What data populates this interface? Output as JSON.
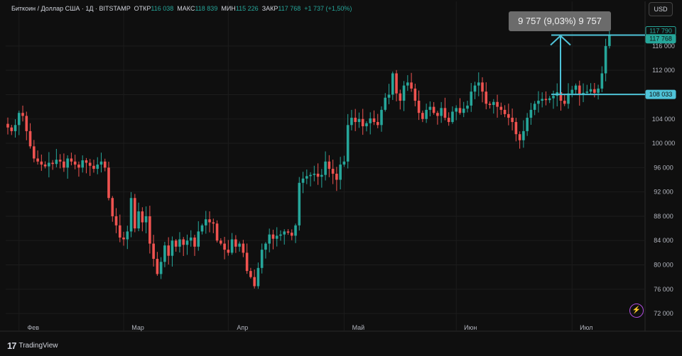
{
  "header": {
    "symbol": "Биткоин / Доллар США · 1Д · BITSTAMP",
    "open_label": "ОТКР",
    "open_value": "116 038",
    "high_label": "МАКС",
    "high_value": "118 839",
    "low_label": "МИН",
    "low_value": "115 226",
    "close_label": "ЗАКР",
    "close_value": "117 768",
    "change": "+1 737 (+1,50%)"
  },
  "currency_button": "USD",
  "measure_label": "9 757 (9,03%) 9 757",
  "branding": "TradingView",
  "colors": {
    "up": "#26a69a",
    "down": "#ef5350",
    "measure_line": "#4fc3d8",
    "background": "#0f0f0f"
  },
  "chart_data": {
    "type": "candlestick",
    "symbol": "BTC/USD",
    "timeframe": "1D",
    "x_labels": [
      "Фев",
      "Мар",
      "Апр",
      "Май",
      "Июн",
      "Июл"
    ],
    "y_ticks": [
      72000,
      76000,
      80000,
      84000,
      88000,
      92000,
      96000,
      100000,
      104000,
      108000,
      112000,
      116000
    ],
    "ylim": [
      70500,
      121000
    ],
    "price_labels": [
      {
        "value": 117790,
        "text": "117 790",
        "style": "outline"
      },
      {
        "value": 117768,
        "text": "117 768",
        "style": "filled"
      },
      {
        "value": 108033,
        "text": "108 033",
        "style": "filled"
      }
    ],
    "measure": {
      "from": 108033,
      "to": 117790,
      "text": "9 757 (9,03%) 9 757"
    },
    "month_index": {
      "Фев": 3,
      "Мар": 31,
      "Апр": 59,
      "Май": 90,
      "Июн": 120,
      "Июл": 151
    },
    "anchors": [
      [
        0,
        102600
      ],
      [
        1,
        102000
      ],
      [
        2,
        103000
      ],
      [
        3,
        105000
      ],
      [
        4,
        104500
      ],
      [
        5,
        102000
      ],
      [
        6,
        99500
      ],
      [
        7,
        97500
      ],
      [
        8,
        97000
      ],
      [
        9,
        96500
      ],
      [
        10,
        96200
      ],
      [
        11,
        96800
      ],
      [
        12,
        96600
      ],
      [
        13,
        97300
      ],
      [
        14,
        97000
      ],
      [
        15,
        96000
      ],
      [
        16,
        97500
      ],
      [
        17,
        97000
      ],
      [
        18,
        96500
      ],
      [
        19,
        96000
      ],
      [
        20,
        97200
      ],
      [
        21,
        96800
      ],
      [
        22,
        96300
      ],
      [
        23,
        95800
      ],
      [
        24,
        96500
      ],
      [
        25,
        97000
      ],
      [
        26,
        96000
      ],
      [
        27,
        91000
      ],
      [
        28,
        88000
      ],
      [
        29,
        86500
      ],
      [
        30,
        84500
      ],
      [
        31,
        84200
      ],
      [
        32,
        85500
      ],
      [
        33,
        91000
      ],
      [
        34,
        86000
      ],
      [
        35,
        88800
      ],
      [
        36,
        87000
      ],
      [
        37,
        88000
      ],
      [
        38,
        83500
      ],
      [
        39,
        81000
      ],
      [
        40,
        78500
      ],
      [
        41,
        80500
      ],
      [
        42,
        83200
      ],
      [
        43,
        81500
      ],
      [
        44,
        84000
      ],
      [
        45,
        83000
      ],
      [
        46,
        84200
      ],
      [
        47,
        83300
      ],
      [
        48,
        84000
      ],
      [
        49,
        84500
      ],
      [
        50,
        83000
      ],
      [
        51,
        85500
      ],
      [
        52,
        86500
      ],
      [
        53,
        87500
      ],
      [
        54,
        87000
      ],
      [
        55,
        86800
      ],
      [
        56,
        84000
      ],
      [
        57,
        83500
      ],
      [
        58,
        82500
      ],
      [
        59,
        82000
      ],
      [
        60,
        84200
      ],
      [
        61,
        83000
      ],
      [
        62,
        83500
      ],
      [
        63,
        82000
      ],
      [
        64,
        79000
      ],
      [
        65,
        78000
      ],
      [
        66,
        76500
      ],
      [
        67,
        79500
      ],
      [
        68,
        82500
      ],
      [
        69,
        83500
      ],
      [
        70,
        85000
      ],
      [
        71,
        84300
      ],
      [
        72,
        84800
      ],
      [
        73,
        85000
      ],
      [
        74,
        85500
      ],
      [
        75,
        85300
      ],
      [
        76,
        84800
      ],
      [
        77,
        86500
      ],
      [
        78,
        93500
      ],
      [
        79,
        94200
      ],
      [
        80,
        94600
      ],
      [
        81,
        94800
      ],
      [
        82,
        95000
      ],
      [
        83,
        94500
      ],
      [
        84,
        94800
      ],
      [
        85,
        97000
      ],
      [
        86,
        95800
      ],
      [
        87,
        95000
      ],
      [
        88,
        94000
      ],
      [
        89,
        96500
      ],
      [
        90,
        97000
      ],
      [
        91,
        103000
      ],
      [
        92,
        104200
      ],
      [
        93,
        103500
      ],
      [
        94,
        104000
      ],
      [
        95,
        102800
      ],
      [
        96,
        103300
      ],
      [
        97,
        104100
      ],
      [
        98,
        103500
      ],
      [
        99,
        103000
      ],
      [
        100,
        105500
      ],
      [
        101,
        107500
      ],
      [
        102,
        108000
      ],
      [
        103,
        111500
      ],
      [
        104,
        108200
      ],
      [
        105,
        107000
      ],
      [
        106,
        109500
      ],
      [
        107,
        110000
      ],
      [
        108,
        109000
      ],
      [
        109,
        107000
      ],
      [
        110,
        105000
      ],
      [
        111,
        104000
      ],
      [
        112,
        105500
      ],
      [
        113,
        106000
      ],
      [
        114,
        105000
      ],
      [
        115,
        104500
      ],
      [
        116,
        105800
      ],
      [
        117,
        104200
      ],
      [
        118,
        103500
      ],
      [
        119,
        105200
      ],
      [
        120,
        105800
      ],
      [
        121,
        105000
      ],
      [
        122,
        105700
      ],
      [
        123,
        106200
      ],
      [
        124,
        108500
      ],
      [
        125,
        109500
      ],
      [
        126,
        110000
      ],
      [
        127,
        108500
      ],
      [
        128,
        106500
      ],
      [
        129,
        106300
      ],
      [
        130,
        106800
      ],
      [
        131,
        106000
      ],
      [
        132,
        105500
      ],
      [
        133,
        104800
      ],
      [
        134,
        104200
      ],
      [
        135,
        103500
      ],
      [
        136,
        101500
      ],
      [
        137,
        100500
      ],
      [
        138,
        102000
      ],
      [
        139,
        104200
      ],
      [
        140,
        105500
      ],
      [
        141,
        106500
      ],
      [
        142,
        107000
      ],
      [
        143,
        107300
      ],
      [
        144,
        107100
      ],
      [
        145,
        107400
      ],
      [
        146,
        107800
      ],
      [
        147,
        108400
      ],
      [
        148,
        107000
      ],
      [
        149,
        106500
      ],
      [
        150,
        108200
      ],
      [
        151,
        108800
      ],
      [
        152,
        109500
      ],
      [
        153,
        108000
      ],
      [
        154,
        108300
      ],
      [
        155,
        108500
      ],
      [
        156,
        108900
      ],
      [
        157,
        108300
      ],
      [
        158,
        109000
      ],
      [
        159,
        111500
      ],
      [
        160,
        116000
      ],
      [
        161,
        117768
      ]
    ]
  }
}
